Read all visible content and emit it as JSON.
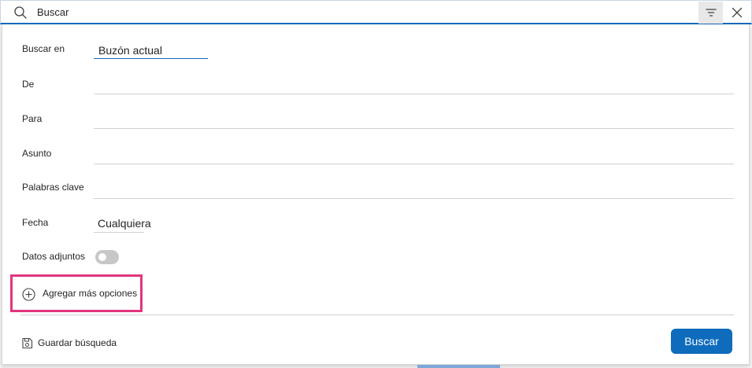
{
  "search_bar": {
    "query": "Buscar"
  },
  "panel": {
    "fields": {
      "search_in": {
        "label": "Buscar en",
        "value": "Buzón actual"
      },
      "from": {
        "label": "De"
      },
      "to": {
        "label": "Para"
      },
      "subject": {
        "label": "Asunto"
      },
      "keywords": {
        "label": "Palabras clave"
      },
      "date": {
        "label": "Fecha",
        "value": "Cualquiera"
      },
      "attachments": {
        "label": "Datos adjuntos",
        "enabled": false
      }
    },
    "add_options_label": "Agregar más opciones",
    "save_search_label": "Guardar búsqueda",
    "search_button_label": "Buscar"
  },
  "colors": {
    "accent": "#0f6cbd",
    "highlight": "#e0357e",
    "toggle_off": "#c7c7c7"
  },
  "icons": [
    "search-icon",
    "filter-icon",
    "close-icon",
    "add-circle-icon",
    "save-icon"
  ]
}
